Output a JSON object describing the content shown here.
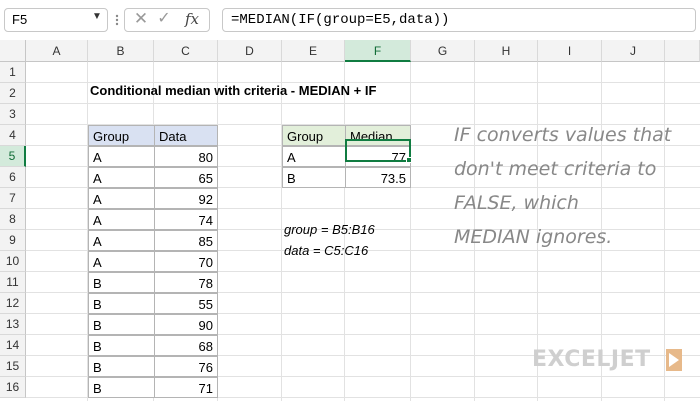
{
  "name_box": "F5",
  "formula": "=MEDIAN(IF(group=E5,data))",
  "columns": [
    "A",
    "B",
    "C",
    "D",
    "E",
    "F",
    "G",
    "H",
    "I",
    "J"
  ],
  "rows": [
    "1",
    "2",
    "3",
    "4",
    "5",
    "6",
    "7",
    "8",
    "9",
    "10",
    "11",
    "12",
    "13",
    "14",
    "15",
    "16"
  ],
  "selected_cell": "F5",
  "title": "Conditional median with criteria - MEDIAN + IF",
  "data_table": {
    "headers": [
      "Group",
      "Data"
    ],
    "rows": [
      [
        "A",
        "80"
      ],
      [
        "A",
        "65"
      ],
      [
        "A",
        "92"
      ],
      [
        "A",
        "74"
      ],
      [
        "A",
        "85"
      ],
      [
        "A",
        "70"
      ],
      [
        "B",
        "78"
      ],
      [
        "B",
        "55"
      ],
      [
        "B",
        "90"
      ],
      [
        "B",
        "68"
      ],
      [
        "B",
        "76"
      ],
      [
        "B",
        "71"
      ]
    ]
  },
  "summary_table": {
    "headers": [
      "Group",
      "Median"
    ],
    "rows": [
      [
        "A",
        "77"
      ],
      [
        "B",
        "73.5"
      ]
    ]
  },
  "notes": [
    "group = B5:B16",
    "data = C5:C16"
  ],
  "callout": [
    "IF converts values that",
    "don't meet criteria to",
    "FALSE, which",
    "MEDIAN ignores."
  ],
  "logo_text": "EXCELJET",
  "colors": {
    "header_blue": "#d9e1f2",
    "header_green": "#e2efda",
    "selection_green": "#107c41",
    "callout_gray": "#888888"
  },
  "icons": [
    "chevron-down-icon",
    "cancel-icon",
    "enter-icon",
    "function-icon"
  ]
}
